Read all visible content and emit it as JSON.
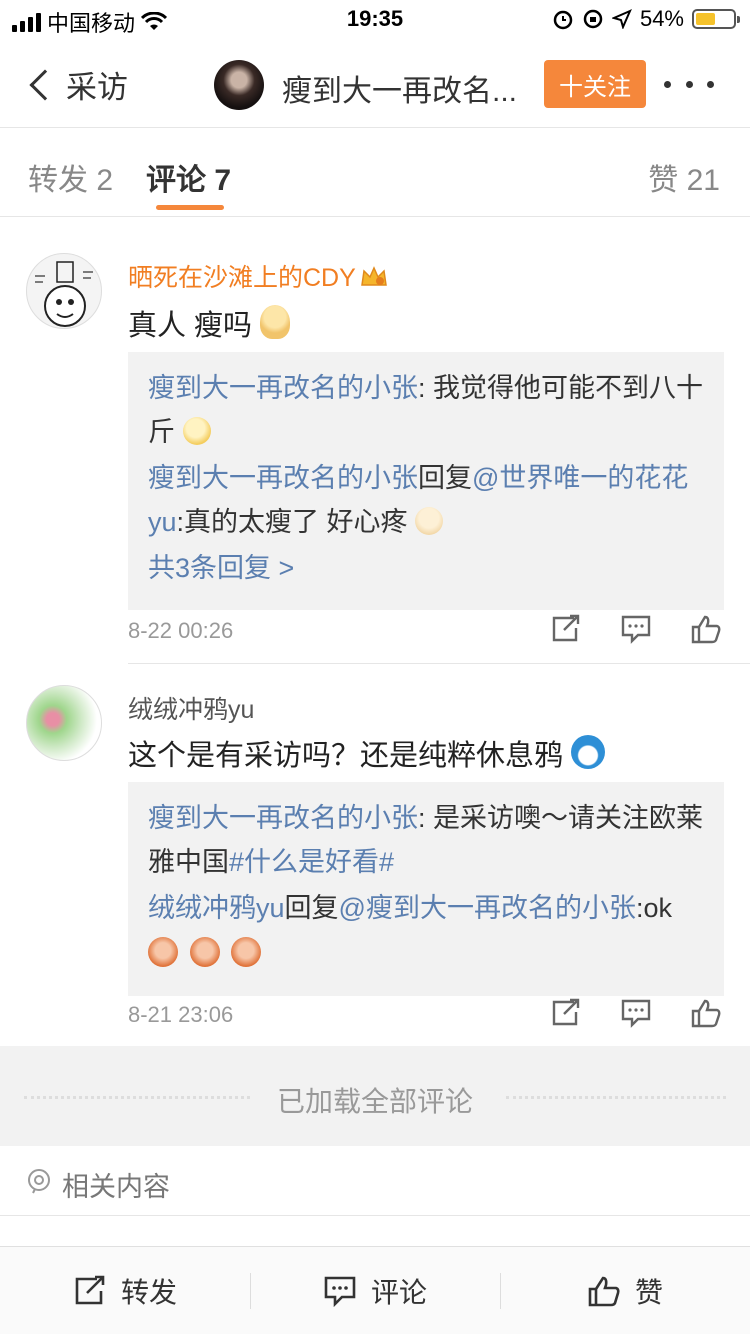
{
  "status_bar": {
    "carrier": "中国移动",
    "time": "19:35",
    "battery_percent": "54%",
    "battery_level": 0.54,
    "icons": [
      "signal-icon",
      "wifi-icon",
      "alarm-icon",
      "rotation-lock-icon",
      "location-icon",
      "battery-icon"
    ]
  },
  "nav": {
    "back_label": "采访",
    "title": "瘦到大一再改名...",
    "follow_label": "十关注"
  },
  "tabs": {
    "repost": "转发 2",
    "comment": "评论 7",
    "like": "赞 21"
  },
  "comments": [
    {
      "user": "晒死在沙滩上的CDY",
      "text": "真人 瘦吗",
      "reply_lines": [
        {
          "author": "瘦到大一再改名的小张",
          "text": ": 我觉得他可能不到八十斤"
        },
        {
          "author": "瘦到大一再改名的小张",
          "mid": "回复",
          "mention": "@世界唯一的花花yu",
          "text": ":真的太瘦了 好心疼"
        }
      ],
      "more_replies": "共3条回复 >",
      "time": "8-22 00:26"
    },
    {
      "user": "绒绒冲鸦yu",
      "text": "这个是有采访吗？还是纯粹休息鸦",
      "reply_lines": [
        {
          "author": "瘦到大一再改名的小张",
          "text": ": 是采访噢～请关注欧莱雅中国",
          "tag": "#什么是好看#"
        },
        {
          "author": "绒绒冲鸦yu",
          "mid": "回复",
          "mention": "@瘦到大一再改名的小张",
          "text": ":ok"
        }
      ],
      "time": "8-21 23:06"
    }
  ],
  "footer": {
    "loaded_all": "已加载全部评论",
    "related": "相关内容"
  },
  "bottom_bar": {
    "repost": "转发",
    "comment": "评论",
    "like": "赞"
  },
  "colors": {
    "accent_orange": "#f5873b",
    "link_blue": "#5b7fb0",
    "vip_name_orange": "#f17e22"
  }
}
